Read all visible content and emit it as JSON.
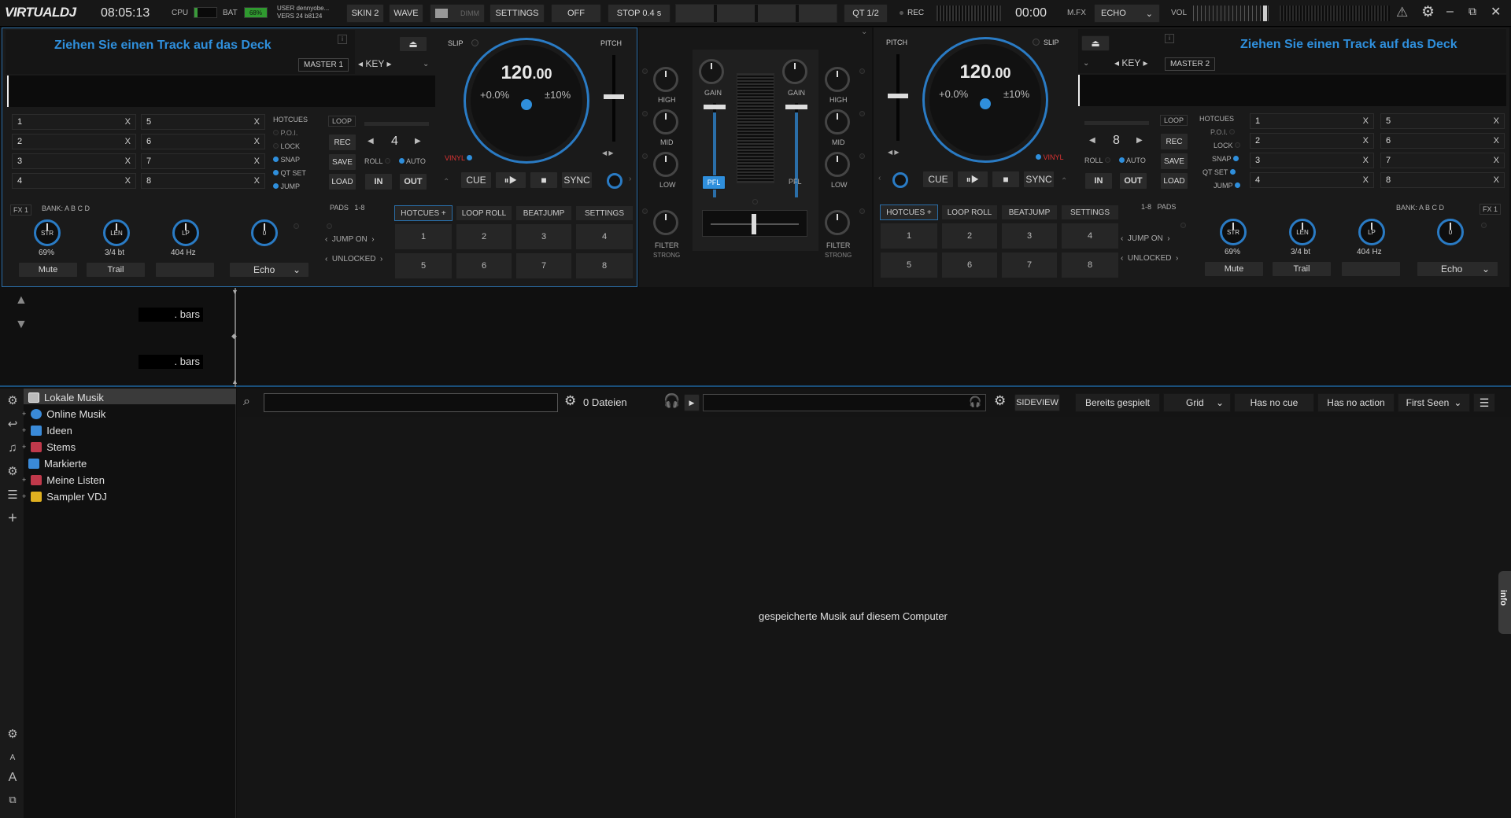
{
  "topbar": {
    "logo": "VIRTUALDJ",
    "time": "08:05:13",
    "cpu": "CPU",
    "bat": "BAT",
    "bat_value": "68%",
    "user": "USER dennyobe...",
    "vers": "VERS 24 b8124",
    "skin": "SKIN 2",
    "wave": "WAVE",
    "dimm": "DIMM",
    "settings": "SETTINGS",
    "off": "OFF",
    "stop": "STOP 0.4 s",
    "qt": "QT 1/2",
    "rec": "REC",
    "rec_time": "00:00",
    "mfx": "M.FX",
    "echo": "ECHO",
    "vol": "VOL"
  },
  "deck_left": {
    "prompt": "Ziehen Sie einen Track auf das Deck",
    "master": "MASTER 1",
    "key": "KEY",
    "slip": "SLIP",
    "pitch": "PITCH",
    "bpm": "120",
    "bpm_dec": ".00",
    "pitch_val": "+0.0%",
    "range": "±10%",
    "vinyl": "VINYL",
    "hotcues": [
      "1",
      "2",
      "3",
      "4",
      "5",
      "6",
      "7",
      "8"
    ],
    "x": "X",
    "hc_label": "HOTCUES",
    "poi": "P.O.I.",
    "lock": "LOCK",
    "snap": "SNAP",
    "qtset": "QT SET",
    "jump": "JUMP",
    "loop": "LOOP",
    "rec": "REC",
    "save": "SAVE",
    "load": "LOAD",
    "loop_size": "4",
    "roll": "ROLL",
    "auto": "AUTO",
    "in": "IN",
    "out": "OUT",
    "cue": "CUE",
    "sync": "SYNC",
    "fx": "FX 1",
    "bank": "BANK:",
    "bank_letters": "A  B  C  D",
    "str": "STR",
    "len": "LEN",
    "lp": "LP",
    "str_val": "69%",
    "len_val": "3/4 bt",
    "lp_val": "404 Hz",
    "fx_knob": "0",
    "mute": "Mute",
    "trail": "Trail",
    "echo": "Echo",
    "pads": "PADS",
    "pads_range": "1-8",
    "tab_hotcues": "HOTCUES +",
    "tab_loop": "LOOP ROLL",
    "tab_beat": "BEATJUMP",
    "tab_settings": "SETTINGS",
    "jump_on": "JUMP ON",
    "unlocked": "UNLOCKED",
    "padnums": [
      "1",
      "2",
      "3",
      "4",
      "5",
      "6",
      "7",
      "8"
    ]
  },
  "deck_right": {
    "prompt": "Ziehen Sie einen Track auf das Deck",
    "master": "MASTER 2",
    "key": "KEY",
    "slip": "SLIP",
    "pitch": "PITCH",
    "bpm": "120",
    "bpm_dec": ".00",
    "pitch_val": "+0.0%",
    "range": "±10%",
    "vinyl": "VINYL",
    "loop": "LOOP",
    "rec": "REC",
    "save": "SAVE",
    "load": "LOAD",
    "loop_size": "8",
    "roll": "ROLL",
    "auto": "AUTO",
    "in": "IN",
    "out": "OUT",
    "hc_label": "HOTCUES",
    "poi": "P.O.I.",
    "lock": "LOCK",
    "snap": "SNAP",
    "qtset": "QT SET",
    "jump": "JUMP",
    "cue": "CUE",
    "sync": "SYNC",
    "fx": "FX 1",
    "bank": "BANK:",
    "bank_letters": "A  B  C  D",
    "str": "STR",
    "len": "LEN",
    "lp": "LP",
    "str_val": "69%",
    "len_val": "3/4 bt",
    "lp_val": "404 Hz",
    "fx_knob": "0",
    "mute": "Mute",
    "trail": "Trail",
    "echo": "Echo",
    "pads": "PADS",
    "pads_range": "1-8",
    "tab_hotcues": "HOTCUES +",
    "tab_loop": "LOOP ROLL",
    "tab_beat": "BEATJUMP",
    "tab_settings": "SETTINGS",
    "jump_on": "JUMP ON",
    "unlocked": "UNLOCKED"
  },
  "mixer": {
    "high": "HIGH",
    "mid": "MID",
    "low": "LOW",
    "gain": "GAIN",
    "pfl": "PFL",
    "filter": "FILTER",
    "strong": "STRONG"
  },
  "wave": {
    "bars1": ". bars",
    "bars2": ". bars"
  },
  "browser": {
    "tree": [
      "Lokale Musik",
      "Online Musik",
      "Ideen",
      "Stems",
      "Markierte",
      "Meine Listen",
      "Sampler VDJ"
    ],
    "files": "0 Dateien",
    "sideview": "SIDEVIEW",
    "filters": [
      "Bereits gespielt",
      "Grid",
      "Has no cue",
      "Has no action",
      "First Seen"
    ],
    "empty": "gespeicherte Musik auf diesem Computer",
    "info": "info"
  }
}
